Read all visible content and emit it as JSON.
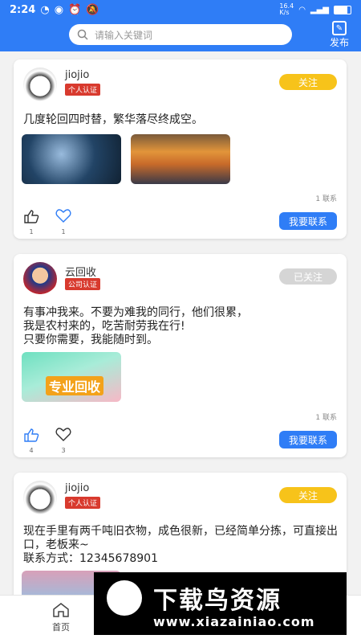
{
  "status_bar": {
    "time": "2:24",
    "network": "16.4\nK/s"
  },
  "header": {
    "search_placeholder": "请输入关键词",
    "publish_label": "发布"
  },
  "posts": [
    {
      "user": "jiojio",
      "badge": "个人认证",
      "follow_label": "关注",
      "text": "几度轮回四时替，繁华落尽终成空。",
      "contact_count": "1 联系",
      "likes": "1",
      "favorites": "1",
      "contact_label": "我要联系"
    },
    {
      "user": "云回收",
      "badge": "公司认证",
      "follow_label": "已关注",
      "text": "有事冲我来。不要为难我的同行，他们很累，\n我是农村来的，吃苦耐劳我在行!\n只要你需要，我能随时到。",
      "image_text": "专业回收",
      "contact_count": "1 联系",
      "likes": "4",
      "favorites": "3",
      "contact_label": "我要联系"
    },
    {
      "user": "jiojio",
      "badge": "个人认证",
      "follow_label": "关注",
      "text": "现在手里有两千吨旧衣物，成色很新，已经简单分拣，可直接出口，老板来~\n联系方式：12345678901"
    }
  ],
  "tabbar": {
    "home_label": "首页"
  },
  "watermark": {
    "title": "下载鸟资源",
    "url": "www.xiazainiao.com"
  },
  "colors": {
    "primary": "#2f7df6",
    "follow": "#f7c31a",
    "badge": "#d83a2e"
  }
}
